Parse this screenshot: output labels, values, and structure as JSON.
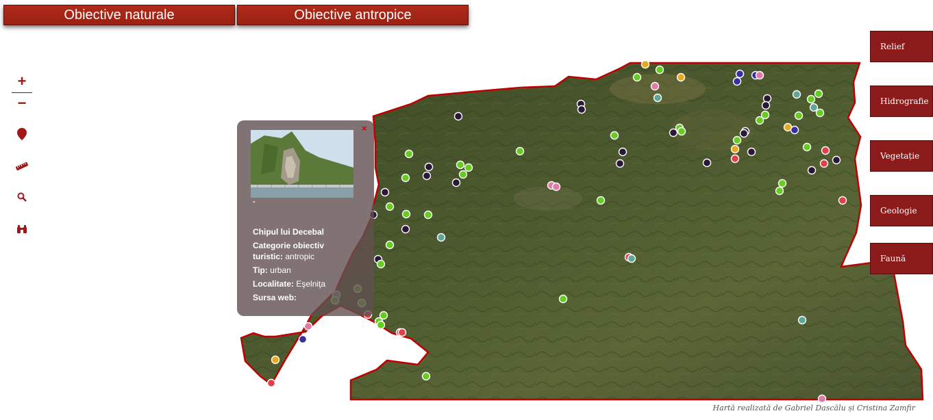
{
  "tabs": {
    "natural": "Obiective naturale",
    "anthropic": "Obiective antropice"
  },
  "toolbar": {
    "zoom_in": "+",
    "zoom_out": "−"
  },
  "layers": [
    "Relief",
    "Hidrografie",
    "Vegetație",
    "Geologie",
    "Faună"
  ],
  "popup": {
    "photo_caption": "\"",
    "title": "Chipul lui Decebal",
    "category_label": "Categorie obiectiv turistic:",
    "category_value": "antropic",
    "type_label": "Tip:",
    "type_value": "urban",
    "locality_label": "Localitate:",
    "locality_value": "Eşelniţa",
    "web_label": "Sursa web:",
    "web_value": "",
    "close": "×"
  },
  "attribution": "Hartă realizată de Gabriel Dascălu și Cristina Zamfir",
  "colors": {
    "accent": "#8b1a1a",
    "border": "#c00000",
    "marker_green": "#66cc22",
    "marker_dark": "#2a1838",
    "marker_red": "#e04048",
    "marker_pink": "#e07aa8",
    "marker_blue": "#3a2fa0",
    "marker_teal": "#5fa694",
    "marker_orange": "#e8a820"
  }
}
